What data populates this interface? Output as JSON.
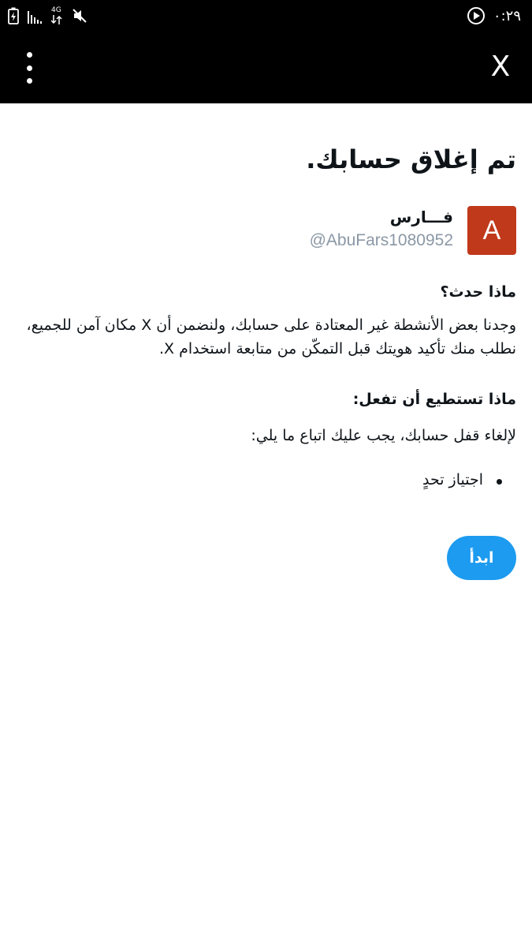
{
  "status_bar": {
    "time": "٠:٢٩",
    "network_label": "4G"
  },
  "header": {
    "close_label": "X"
  },
  "page": {
    "title": "تم إغلاق حسابك."
  },
  "account": {
    "avatar_letter": "A",
    "display_name": "فـــارس",
    "handle": "@AbuFars1080952"
  },
  "what_happened": {
    "heading": "ماذا حدث؟",
    "text": "وجدنا بعض الأنشطة غير المعتادة على حسابك، ولنضمن أن X مكان آمن للجميع، نطلب منك تأكيد هويتك قبل التمكّن من متابعة استخدام X."
  },
  "what_to_do": {
    "heading": "ماذا تستطيع أن تفعل:",
    "text": "لإلغاء قفل حسابك، يجب عليك اتباع ما يلي:",
    "steps": [
      "اجتياز تحدٍ"
    ]
  },
  "actions": {
    "start_label": "ابدأ"
  },
  "colors": {
    "accent": "#1d9bf0",
    "avatar_bg": "#c0391b",
    "header_bg": "#000000",
    "handle_text": "#8b98a5"
  }
}
